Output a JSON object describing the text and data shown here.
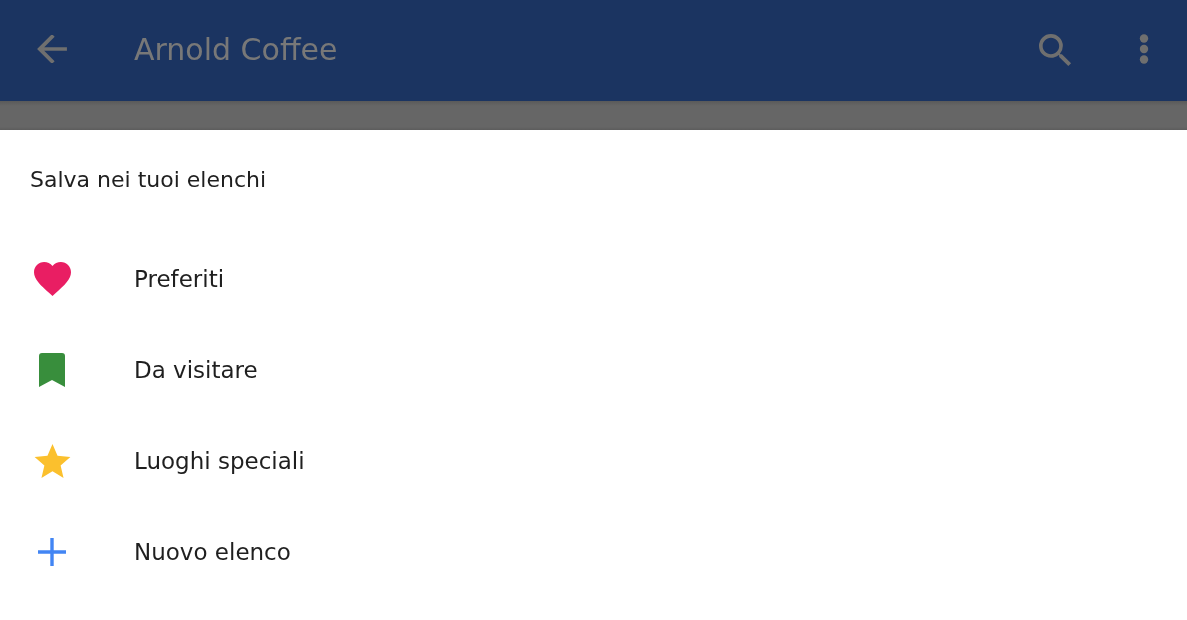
{
  "app_bar": {
    "title": "Arnold Coffee"
  },
  "sheet": {
    "title": "Salva nei tuoi elenchi",
    "lists": [
      {
        "kind": "heart",
        "label": "Preferiti",
        "color": "#e91e63"
      },
      {
        "kind": "bookmark",
        "label": "Da visitare",
        "color": "#388e3c"
      },
      {
        "kind": "star",
        "label": "Luoghi speciali",
        "color": "#fbc02d"
      },
      {
        "kind": "plus",
        "label": "Nuovo elenco",
        "color": "#4285f4"
      }
    ]
  }
}
